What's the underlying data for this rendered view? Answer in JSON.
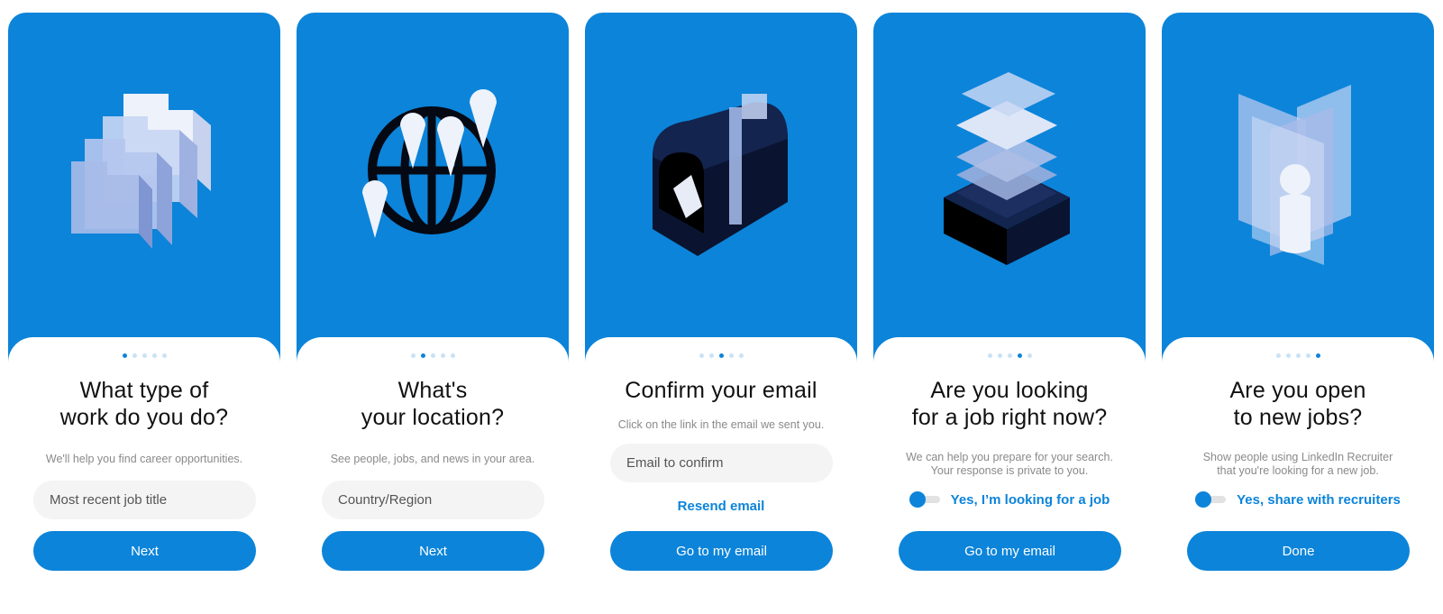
{
  "steps": [
    {
      "title_line1": "What type of",
      "title_line2": "work do you do?",
      "subtitle_line1": "We'll help you find career opportunities.",
      "input_placeholder": "Most recent job title",
      "button_label": "Next",
      "icon": "folders-icon"
    },
    {
      "title_line1": "What's",
      "title_line2": "your location?",
      "subtitle_line1": "See people, jobs, and news in your area.",
      "input_placeholder": "Country/Region",
      "button_label": "Next",
      "icon": "globe-pins-icon"
    },
    {
      "title_line1": "Confirm your email",
      "subtitle_line1": "Click on the link in the email we sent you.",
      "input_placeholder": "Email to confirm",
      "link_label": "Resend email",
      "button_label": "Go to my email",
      "icon": "mailbox-icon"
    },
    {
      "title_line1": "Are you looking",
      "title_line2": "for a job right now?",
      "subtitle_line1": "We can help you prepare for your search.",
      "subtitle_line2": "Your response is private to you.",
      "toggle_label": "Yes, I’m looking for a job",
      "button_label": "Go to my email",
      "icon": "stacked-trays-icon"
    },
    {
      "title_line1": "Are you open",
      "title_line2": "to new jobs?",
      "subtitle_line1": "Show people using LinkedIn Recruiter",
      "subtitle_line2": "that you're looking for a new job.",
      "toggle_label": "Yes, share with recruiters",
      "button_label": "Done",
      "icon": "person-panels-icon"
    }
  ],
  "progress": {
    "total": 5
  },
  "colors": {
    "brand_blue": "#0c84d9",
    "title_text": "#111111",
    "muted_text": "#8a8a8a",
    "input_bg": "#f4f4f4"
  }
}
